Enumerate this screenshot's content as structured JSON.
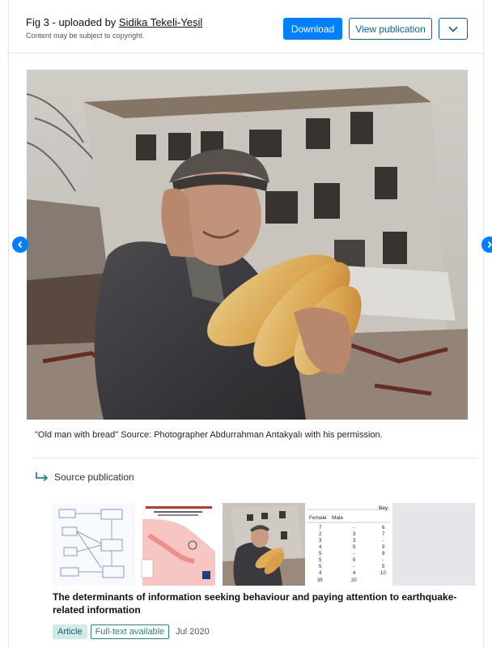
{
  "header": {
    "fig_prefix": "Fig 3 - uploaded by ",
    "uploader": "Sidika Tekeli-Yeşil",
    "copyright_note": "Content may be subject to copyright.",
    "download_label": "Download",
    "view_publication_label": "View publication",
    "more_icon": "chevron-down-icon"
  },
  "figure": {
    "caption": "\"Old man with bread\" Source: Photographer Abdurrahman Antakyalı with his permission.",
    "prev_icon": "chevron-left-icon",
    "next_icon": "chevron-right-icon"
  },
  "source": {
    "icon": "arrow-turn-right-icon",
    "label": "Source publication"
  },
  "publication": {
    "title": "The determinants of information seeking behaviour and paying attention to earthquake-related information",
    "type_badge": "Article",
    "fulltext_badge": "Full-text available",
    "date": "Jul 2020"
  },
  "thumb_table": {
    "headers": [
      "Female",
      "Male",
      "Bey"
    ],
    "rows": [
      [
        "7",
        "-",
        "6"
      ],
      [
        "2",
        "3",
        "7"
      ],
      [
        "3",
        "3",
        "-"
      ],
      [
        "4",
        "5",
        "5"
      ],
      [
        "5",
        "-",
        "9"
      ],
      [
        "5",
        "5",
        "-"
      ],
      [
        "5",
        "-",
        "5"
      ],
      [
        "4",
        "4",
        "10"
      ],
      [
        "35",
        "20",
        ""
      ]
    ]
  },
  "colors": {
    "primary": "#0080ff",
    "outline": "#0b5fa8",
    "badge_bg": "#cfeaea",
    "badge_teal": "#1f8a8f"
  }
}
